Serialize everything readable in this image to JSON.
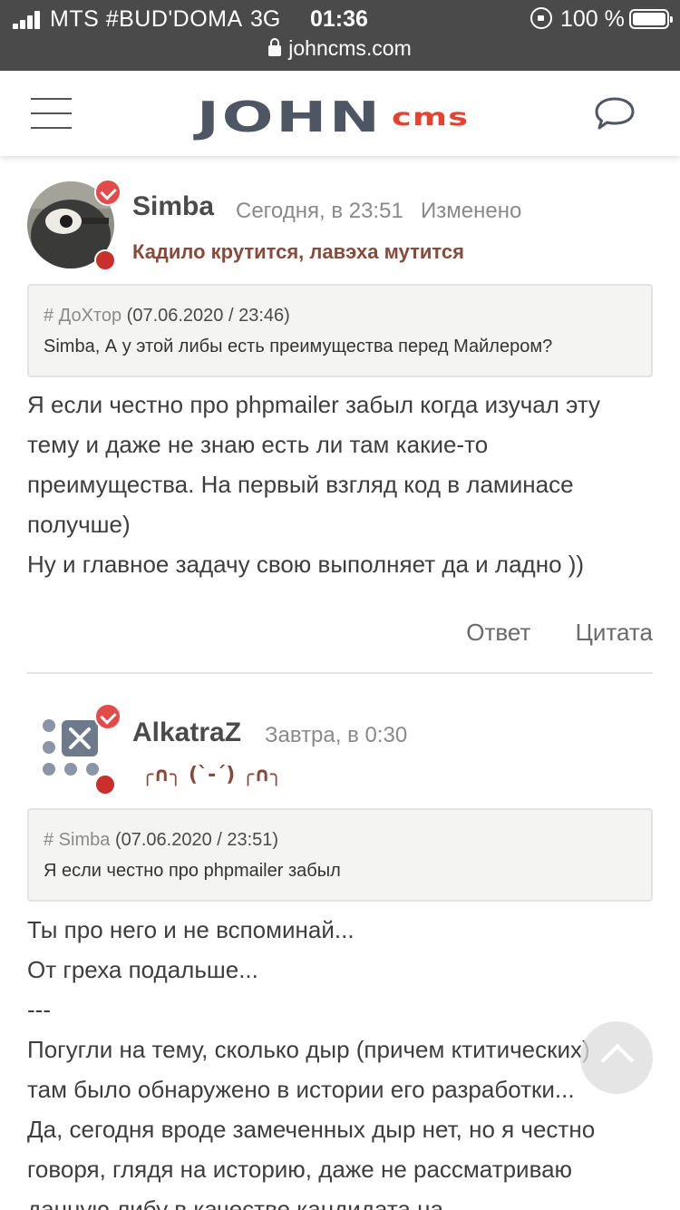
{
  "status_bar": {
    "carrier": "MTS #BUD'DOMA",
    "network": "3G",
    "time": "01:36",
    "battery": "100 %",
    "url": "johncms.com"
  },
  "header": {
    "logo_main": "JOHN",
    "logo_sub": "cms",
    "brand_color": "#e8412f"
  },
  "posts": [
    {
      "user": "Simba",
      "date": "Сегодня, в 23:51",
      "edited": "Изменено",
      "status": "Кадило крутится, лавэха мутится",
      "quote": {
        "author": "# ДоХтор",
        "date": "(07.06.2020 / 23:46)",
        "text": "Simba, А у этой либы есть преимущества перед Майлером?"
      },
      "lines": [
        "Я если честно про phpmailer забыл когда изучал эту",
        "тему и даже не знаю есть ли там какие-то",
        "преимущества. На первый взгляд код в ламинасе",
        "получше)",
        "Ну и главное задачу свою выполняет да и ладно ))"
      ],
      "reply": "Ответ",
      "quote_action": "Цитата"
    },
    {
      "user": "AlkatraZ",
      "date": "Завтра, в 0:30",
      "status": "╭∩╮ (`-´) ╭∩╮",
      "quote": {
        "author": "# Simba",
        "date": "(07.06.2020 / 23:51)",
        "text": "Я если честно про phpmailer забыл"
      },
      "lines": [
        "Ты про него и не вспоминай...",
        "От греха подальше...",
        "---",
        "Погугли на тему, сколько дыр (причем ктитических)",
        "там было обнаружено в истории его разработки...",
        "Да, сегодня вроде замеченных дыр нет, но я честно",
        "говоря, глядя на историю, даже не рассматриваю",
        "данную либу в качестве кандидата на"
      ]
    }
  ]
}
